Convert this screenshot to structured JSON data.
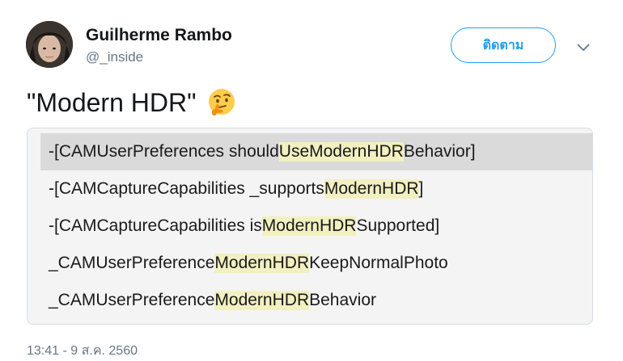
{
  "author": {
    "display_name": "Guilherme Rambo",
    "handle": "@_inside"
  },
  "actions": {
    "follow_label": "ติดตาม",
    "more_icon": "chevron-down-icon"
  },
  "tweet": {
    "text": "\"Modern HDR\"",
    "emoji": "thinking-face"
  },
  "media": {
    "lines": [
      {
        "pre": "-[CAMUserPreferences should",
        "hl": "UseModernHDR",
        "post": "Behavior]"
      },
      {
        "pre": "-[CAMCaptureCapabilities _supports",
        "hl": "ModernHDR",
        "post": "]"
      },
      {
        "pre": "-[CAMCaptureCapabilities is",
        "hl": "ModernHDR",
        "post": "Supported]"
      },
      {
        "pre": "_CAMUserPreference",
        "hl": "ModernHDR",
        "post": "KeepNormalPhoto"
      },
      {
        "pre": "_CAMUserPreference",
        "hl": "ModernHDR",
        "post": "Behavior"
      }
    ]
  },
  "timestamp": "13:41 - 9 ส.ค. 2560",
  "colors": {
    "accent": "#1da1f2",
    "highlight": "#f2f0c0",
    "selected_row": "#dadada"
  }
}
